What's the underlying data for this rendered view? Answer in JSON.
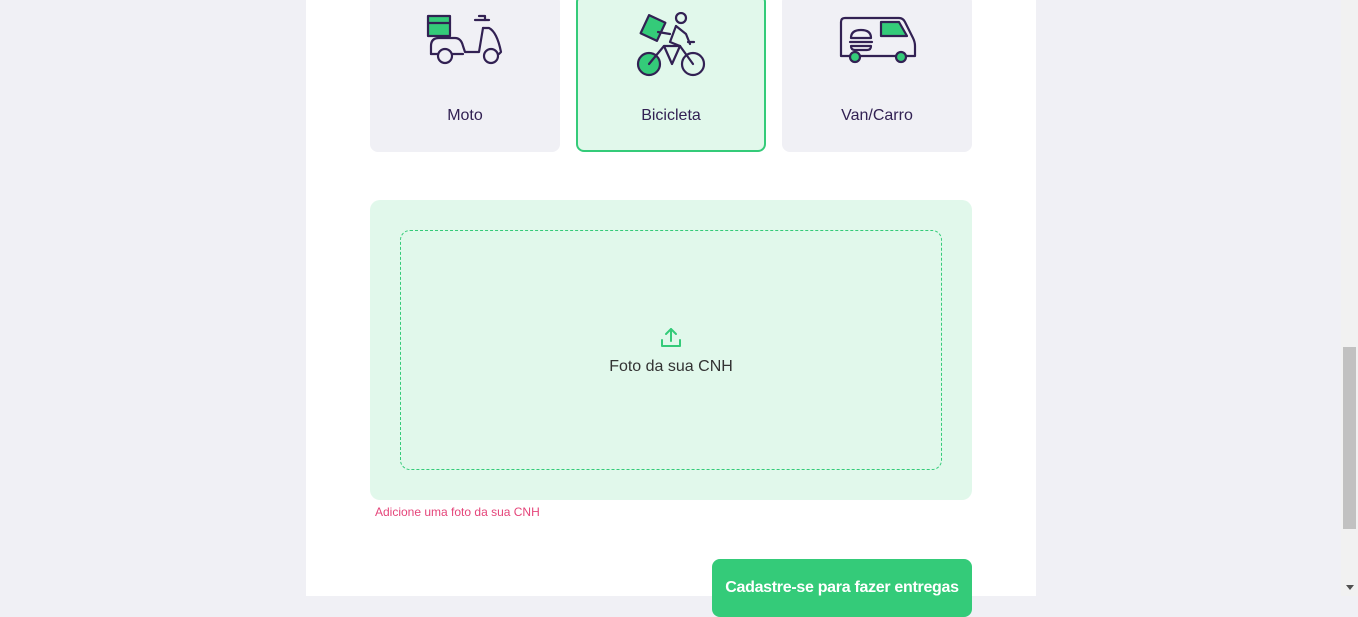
{
  "vehicles": [
    {
      "label": "Moto",
      "icon": "scooter-icon",
      "selected": false
    },
    {
      "label": "Bicicleta",
      "icon": "bicycle-courier-icon",
      "selected": true
    },
    {
      "label": "Van/Carro",
      "icon": "van-icon",
      "selected": false
    }
  ],
  "upload": {
    "label": "Foto da sua CNH",
    "icon": "upload-icon",
    "error": "Adicione uma foto da sua CNH"
  },
  "submit": {
    "label": "Cadastre-se para fazer entregas"
  },
  "colors": {
    "brand_green": "#34cb79",
    "light_green": "#e1f8eb",
    "dark_purple": "#322153",
    "error_pink": "#e5457a"
  }
}
